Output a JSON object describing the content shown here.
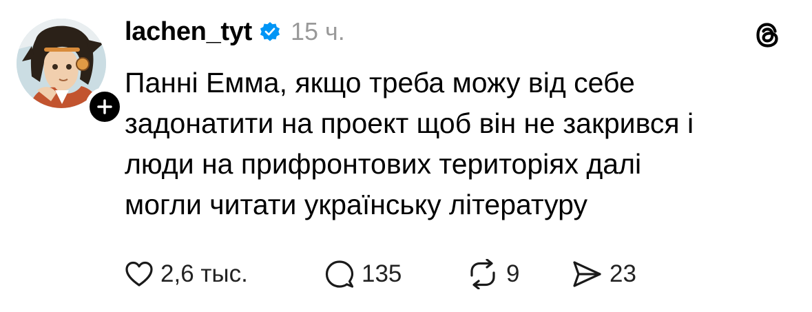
{
  "post": {
    "username": "lachen_tyt",
    "timestamp": "15 ч.",
    "text_lines": [
      "Панні Емма, якщо треба можу від себе",
      "задонатити на проект щоб він не закрився і",
      "люди на прифронтових територіях далі",
      "могли читати українську літературу"
    ]
  },
  "actions": {
    "likes": "2,6 тыс.",
    "replies": "135",
    "reposts": "9",
    "shares": "23"
  },
  "icons": {
    "verified": "verified-badge-icon",
    "follow": "plus-icon",
    "app": "threads-logo-icon",
    "like": "heart-icon",
    "reply": "comment-bubble-icon",
    "repost": "repost-arrows-icon",
    "share": "send-icon"
  },
  "colors": {
    "verified_blue": "#0095f6",
    "timestamp_gray": "#999999",
    "text": "#000000"
  }
}
